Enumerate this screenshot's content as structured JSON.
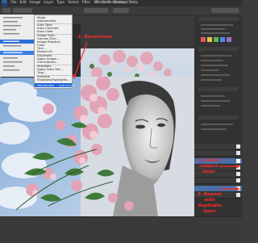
{
  "app": {
    "title": "Adobe Photoshop CC"
  },
  "menubar": {
    "items": [
      "PS",
      "File",
      "Edit",
      "Image",
      "Layer",
      "Type",
      "Select",
      "Filter",
      "3D",
      "View",
      "Window",
      "Help"
    ]
  },
  "image_menu": {
    "items": [
      "Mode",
      "Adjustments",
      "Auto Tone",
      "Auto Contrast",
      "Auto Color",
      "Image Size...",
      "Canvas Size...",
      "Image Rotation",
      "Crop",
      "Trim...",
      "Reveal All",
      "Duplicate...",
      "Apply Image...",
      "Calculations...",
      "Variables",
      "Apply Data Set...",
      "Trap...",
      "Analysis",
      "Brightness/Contrast...",
      "Levels...",
      "Curves...",
      "Exposure...",
      "Vibrance...",
      "Hue/Saturation...",
      "Color Balance...",
      "Black & White...",
      "Photo Filter...",
      "Channel Mixer...",
      "Color Lookup...",
      "Shadows/Highlights...",
      "HDR Toning...",
      "Desaturate",
      "Match Color...",
      "Replace Color...",
      "Equalize"
    ],
    "selected": "Desaturate",
    "selected_shortcut": "Shift+Ctrl+U"
  },
  "annotations": {
    "step2": "2. Desaturate",
    "step1_line1": "1. Select",
    "step1_line2": "subject",
    "step1_line3": "layer",
    "step3_line1": "3. Repeat",
    "step3_line2": "with",
    "step3_line3": "duplicate",
    "step3_line4": "layer"
  },
  "colors": {
    "annotation_red": "#ff2a2a",
    "menu_highlight": "#1f64d8",
    "panel_dark": "#323232",
    "workspace": "#3b3b3b"
  }
}
